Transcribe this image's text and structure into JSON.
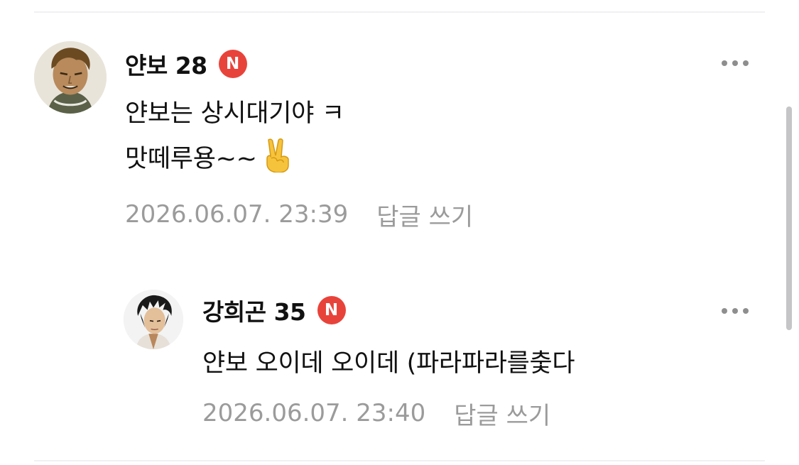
{
  "comments": [
    {
      "author": "얀보 28",
      "badge": "N",
      "lines": [
        "얀보는 상시대기야 ㅋ",
        "맛떼루용~~"
      ],
      "emoji": "victory-hand",
      "timestamp": "2026.06.07. 23:39",
      "reply_label": "답글 쓰기"
    },
    {
      "author": "강희곤 35",
      "badge": "N",
      "lines": [
        "얀보 오이데 오이데 (파라파라를춫다"
      ],
      "timestamp": "2026.06.07. 23:40",
      "reply_label": "답글 쓰기"
    }
  ],
  "colors": {
    "badge": "#e8433a",
    "meta_text": "#9b9b9b",
    "divider": "#f0f0f3",
    "scrollbar": "#c5c5c7"
  }
}
